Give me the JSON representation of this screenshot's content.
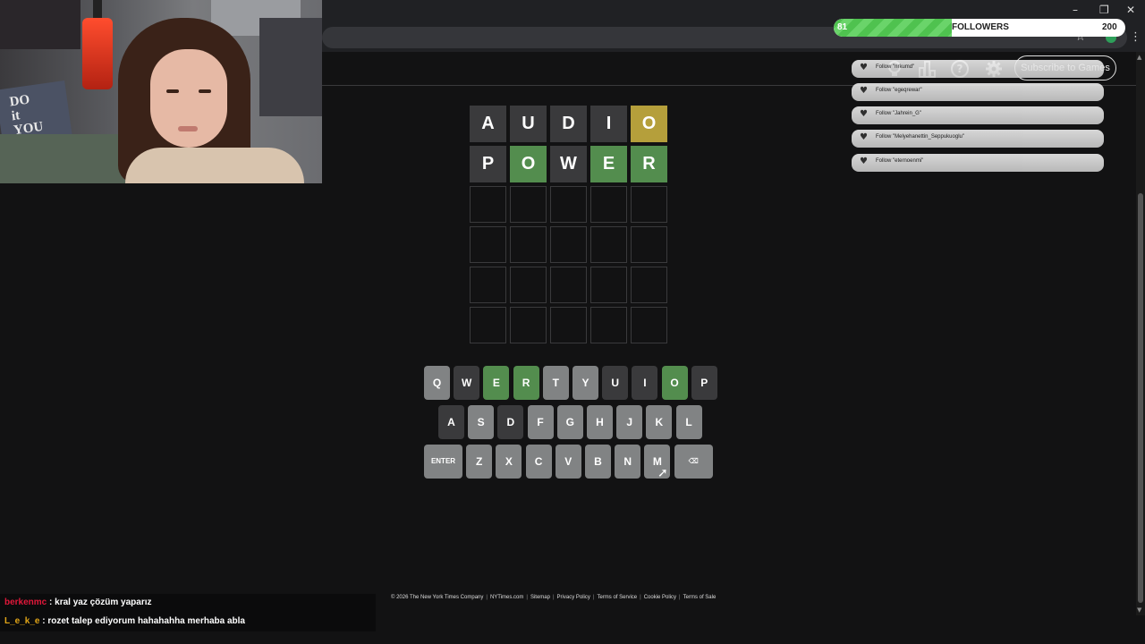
{
  "browser": {
    "colors": {
      "chrome": "#202124",
      "address_bar": "#35363a"
    }
  },
  "stream_overlay": {
    "followers": {
      "current": "81",
      "goal": "200",
      "label": "FOLLOWERS",
      "progress_fraction": 0.405
    },
    "alerts": [
      {
        "text": "Follow \"nrkumd\""
      },
      {
        "text": "Follow \"egeqrewar\""
      },
      {
        "text": "Follow \"Jahrein_G\""
      },
      {
        "text": "Follow \"Melyehanettin_Seppukuoglu\""
      },
      {
        "text": "Follow \"eternoenmi\""
      }
    ],
    "webcam_pillow_text": "DO\nit\nYOU\nYOU"
  },
  "header": {
    "icons": [
      "lightbulb-icon",
      "leaderboard-icon",
      "help-icon",
      "gear-icon"
    ],
    "help_glyph": "?",
    "subscribe_label": "Subscribe to Games"
  },
  "board": {
    "rows": [
      [
        {
          "letter": "A",
          "state": "absent"
        },
        {
          "letter": "U",
          "state": "absent"
        },
        {
          "letter": "D",
          "state": "absent"
        },
        {
          "letter": "I",
          "state": "absent"
        },
        {
          "letter": "O",
          "state": "present"
        }
      ],
      [
        {
          "letter": "P",
          "state": "absent"
        },
        {
          "letter": "O",
          "state": "correct"
        },
        {
          "letter": "W",
          "state": "absent"
        },
        {
          "letter": "E",
          "state": "correct"
        },
        {
          "letter": "R",
          "state": "correct"
        }
      ],
      [
        {
          "letter": "",
          "state": "empty"
        },
        {
          "letter": "",
          "state": "empty"
        },
        {
          "letter": "",
          "state": "empty"
        },
        {
          "letter": "",
          "state": "empty"
        },
        {
          "letter": "",
          "state": "empty"
        }
      ],
      [
        {
          "letter": "",
          "state": "empty"
        },
        {
          "letter": "",
          "state": "empty"
        },
        {
          "letter": "",
          "state": "empty"
        },
        {
          "letter": "",
          "state": "empty"
        },
        {
          "letter": "",
          "state": "empty"
        }
      ],
      [
        {
          "letter": "",
          "state": "empty"
        },
        {
          "letter": "",
          "state": "empty"
        },
        {
          "letter": "",
          "state": "empty"
        },
        {
          "letter": "",
          "state": "empty"
        },
        {
          "letter": "",
          "state": "empty"
        }
      ],
      [
        {
          "letter": "",
          "state": "empty"
        },
        {
          "letter": "",
          "state": "empty"
        },
        {
          "letter": "",
          "state": "empty"
        },
        {
          "letter": "",
          "state": "empty"
        },
        {
          "letter": "",
          "state": "empty"
        }
      ]
    ],
    "colors": {
      "correct": "#538d4e",
      "present": "#b59f3b",
      "absent": "#3a3a3c",
      "empty_border": "#3a3a3c"
    }
  },
  "keyboard": {
    "rows": [
      [
        {
          "label": "Q",
          "state": "unused"
        },
        {
          "label": "W",
          "state": "absent"
        },
        {
          "label": "E",
          "state": "correct"
        },
        {
          "label": "R",
          "state": "correct"
        },
        {
          "label": "T",
          "state": "unused"
        },
        {
          "label": "Y",
          "state": "unused"
        },
        {
          "label": "U",
          "state": "absent"
        },
        {
          "label": "I",
          "state": "absent"
        },
        {
          "label": "O",
          "state": "correct"
        },
        {
          "label": "P",
          "state": "absent"
        }
      ],
      [
        {
          "label": "A",
          "state": "absent"
        },
        {
          "label": "S",
          "state": "unused"
        },
        {
          "label": "D",
          "state": "absent"
        },
        {
          "label": "F",
          "state": "unused"
        },
        {
          "label": "G",
          "state": "unused"
        },
        {
          "label": "H",
          "state": "unused"
        },
        {
          "label": "J",
          "state": "unused"
        },
        {
          "label": "K",
          "state": "unused"
        },
        {
          "label": "L",
          "state": "unused"
        }
      ],
      [
        {
          "label": "ENTER",
          "state": "unused",
          "wide": true
        },
        {
          "label": "Z",
          "state": "unused"
        },
        {
          "label": "X",
          "state": "unused"
        },
        {
          "label": "C",
          "state": "unused"
        },
        {
          "label": "V",
          "state": "unused"
        },
        {
          "label": "B",
          "state": "unused"
        },
        {
          "label": "N",
          "state": "unused"
        },
        {
          "label": "M",
          "state": "unused"
        },
        {
          "label": "⌫",
          "state": "unused",
          "wide": true,
          "icon": "backspace-icon"
        }
      ]
    ],
    "colors": {
      "unused": "#818384"
    }
  },
  "footer": {
    "links": [
      "© 2026 The New York Times Company",
      "NYTimes.com",
      "Sitemap",
      "Privacy Policy",
      "Terms of Service",
      "Cookie Policy",
      "Terms of Sale"
    ]
  },
  "chat": {
    "messages": [
      {
        "user": "berkenmc",
        "text": " : kral yaz çözüm yaparız"
      },
      {
        "user": "L_e_k_e",
        "text": " : rozet talep ediyorum hahahahha merhaba abla"
      }
    ]
  }
}
